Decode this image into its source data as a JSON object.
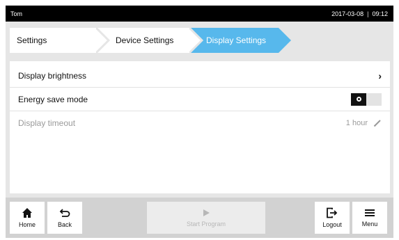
{
  "status_bar": {
    "user": "Tom",
    "date": "2017-03-08",
    "separator": "|",
    "time": "09:12"
  },
  "breadcrumb": [
    {
      "label": "Settings"
    },
    {
      "label": "Device Settings"
    },
    {
      "label": "Display Settings",
      "active": true
    }
  ],
  "settings": {
    "brightness": {
      "label": "Display brightness",
      "chevron": "›"
    },
    "energy_save": {
      "label": "Energy save mode",
      "toggle_on": false
    },
    "timeout": {
      "label": "Display timeout",
      "value": "1 hour",
      "enabled": false
    }
  },
  "bottom_nav": {
    "home": {
      "label": "Home",
      "icon": "home-icon"
    },
    "back": {
      "label": "Back",
      "icon": "back-arrow-icon"
    },
    "start": {
      "label": "Start Program",
      "icon": "play-icon",
      "enabled": false
    },
    "logout": {
      "label": "Logout",
      "icon": "logout-icon"
    },
    "menu": {
      "label": "Menu",
      "icon": "hamburger-icon"
    }
  },
  "colors": {
    "accent": "#57b8ec",
    "status_bar": "#000000",
    "background": "#e6e6e6",
    "disabled_text": "#9a9a9a"
  }
}
